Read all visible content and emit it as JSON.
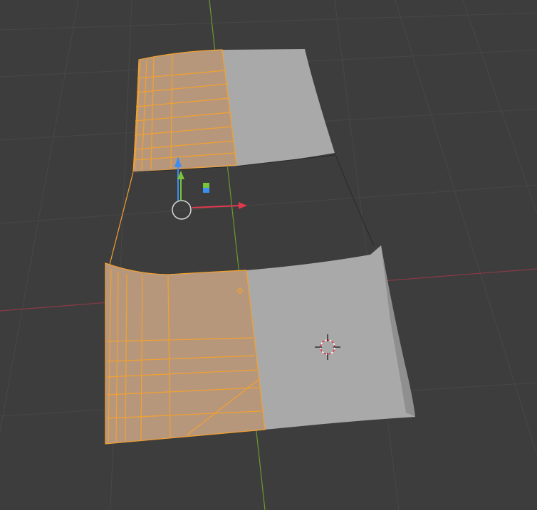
{
  "viewport": {
    "background_color": "#3d3d3d",
    "grid_color": "#474747",
    "x_axis_color": "#8a3a45",
    "y_axis_color": "#6b9a2f"
  },
  "selection": {
    "selected_face_color": "#b7977c",
    "selected_edge_color": "#f2a12f",
    "unselected_face_color": "#a9a9a9"
  },
  "gizmo": {
    "x_color": "#e0394e",
    "y_color": "#7ac43a",
    "z_color": "#3d8ef0"
  },
  "icons": {
    "origin": "origin-circle-icon",
    "cursor": "3d-cursor-icon",
    "object_marker": "object-origin-icon"
  }
}
